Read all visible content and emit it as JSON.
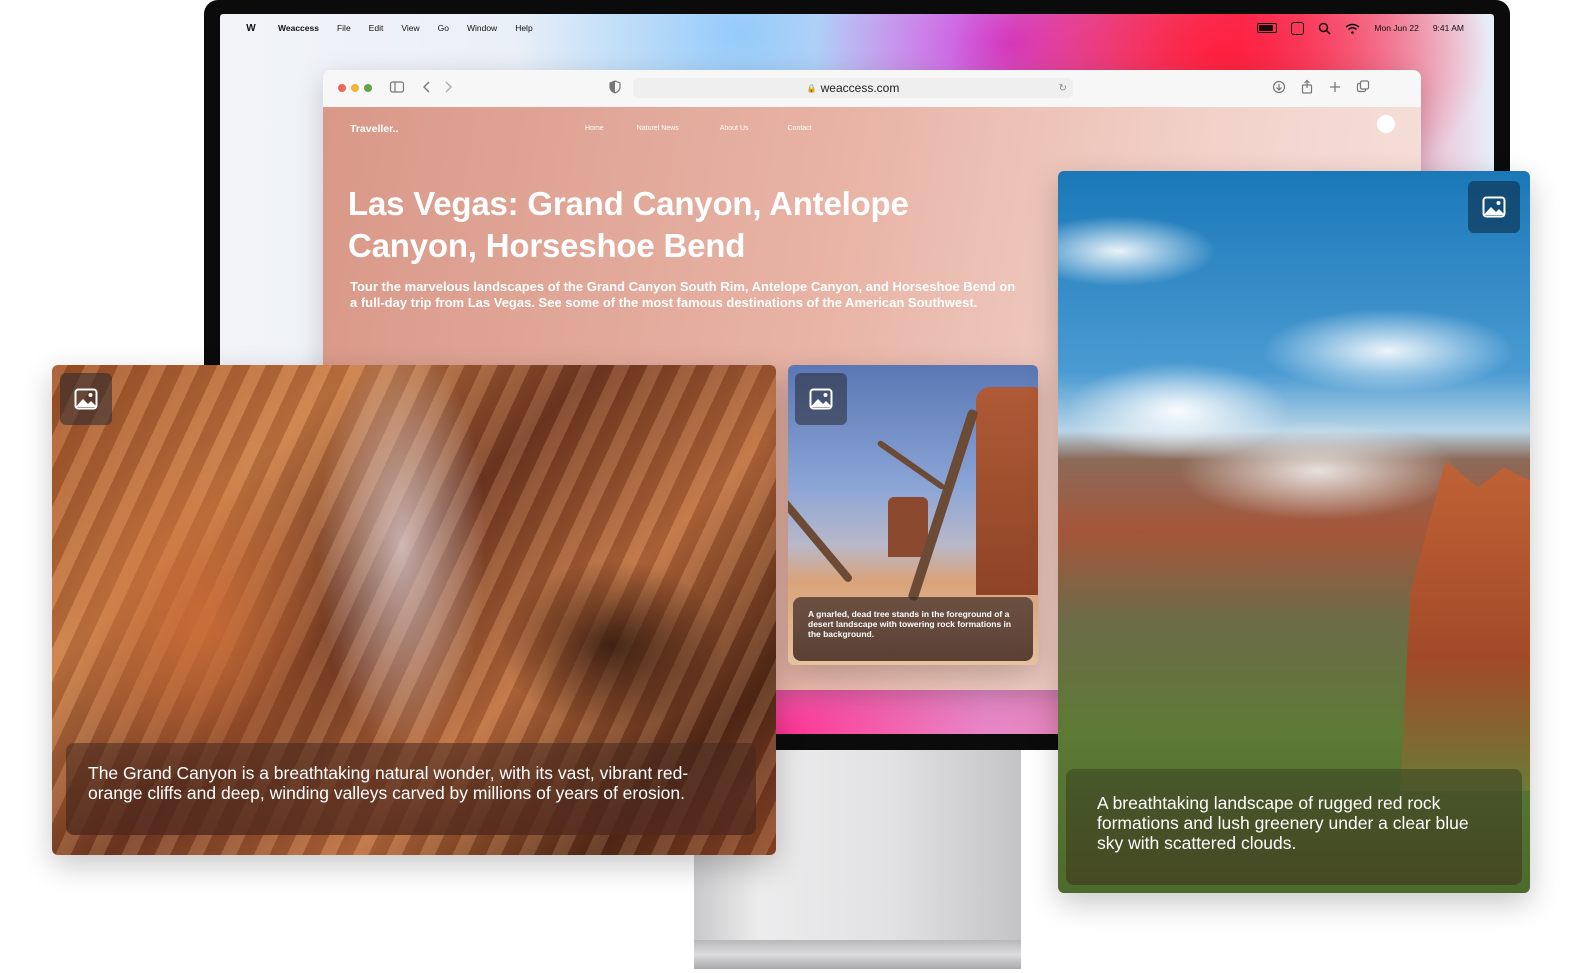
{
  "menubar": {
    "app": "Weaccess",
    "items": [
      "File",
      "Edit",
      "View",
      "Go",
      "Window",
      "Help"
    ],
    "date": "Mon Jun 22",
    "time": "9:41 AM"
  },
  "browser": {
    "url": "weaccess.com"
  },
  "site": {
    "brand": "Traveller..",
    "nav": [
      "Home",
      "Naturel News",
      "About Us",
      "Contact"
    ],
    "headline": "Las Vegas: Grand Canyon, Antelope Canyon, Horseshoe Bend",
    "lede": "Tour the marvelous landscapes of the Grand Canyon South Rim, Antelope Canyon, and Horseshoe Bend on a full-day trip from Las Vegas. See some of the most famous destinations of the American Southwest."
  },
  "cards": {
    "canyon": {
      "caption": "The Grand Canyon is a breathtaking natural wonder, with its vast, vibrant red-orange cliffs and deep, winding valleys carved by millions of years of erosion."
    },
    "tree": {
      "caption": "A gnarled, dead tree stands in the foreground of a desert landscape with towering rock formations in the background."
    },
    "zion": {
      "caption": "A breathtaking landscape of rugged red rock formations and lush greenery under a clear blue sky with scattered clouds."
    }
  },
  "icons": {
    "image": "image-icon",
    "back": "chevron-left-icon",
    "forward": "chevron-right-icon",
    "sidebar": "sidebar-icon",
    "shield": "shield-icon",
    "download": "download-icon",
    "share": "share-icon",
    "new_tab": "plus-icon",
    "tabs": "tabs-icon"
  },
  "colors": {
    "page_accent": "#d99888",
    "traffic_red": "#f46458",
    "traffic_yellow": "#f2b53c",
    "traffic_green": "#5ea54b"
  }
}
